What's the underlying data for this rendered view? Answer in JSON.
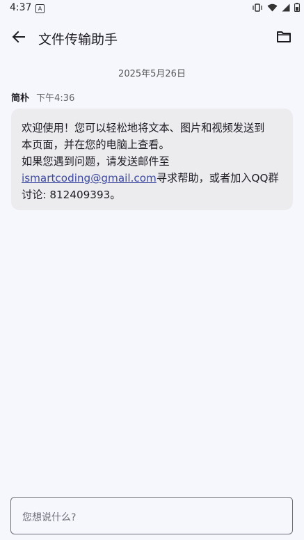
{
  "status_bar": {
    "time": "4:37",
    "notification_icon": "A"
  },
  "app_bar": {
    "title": "文件传输助手",
    "back_icon": "arrow-left-icon",
    "folder_icon": "folder-icon"
  },
  "chat": {
    "date_separator": "2025年5月26日",
    "messages": [
      {
        "sender": "简朴",
        "time": "下午4:36",
        "line1": "欢迎使用！您可以轻松地将文本、图片和视频发送到",
        "line2": "本页面，并在您的电脑上查看。",
        "line3": "如果您遇到问题，请发送邮件至",
        "email": "ismartcoding@gmail.com",
        "line4_rest": "寻求帮助，或者加入QQ群",
        "line5": "讨论: 812409393。"
      }
    ]
  },
  "composer": {
    "placeholder": "您想说什么?"
  },
  "colors": {
    "background": "#f6f7fd",
    "bubble": "#ececef",
    "link": "#3d4aa0"
  }
}
